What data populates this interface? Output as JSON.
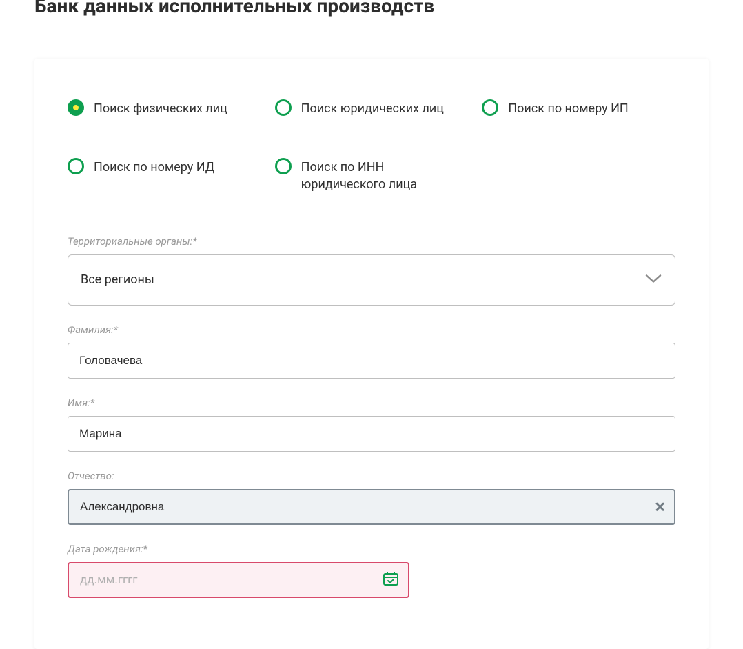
{
  "title": "Банк данных исполнительных производств",
  "radios": [
    {
      "label": "Поиск физических лиц",
      "selected": true
    },
    {
      "label": "Поиск юридических лиц",
      "selected": false
    },
    {
      "label": "Поиск по номеру ИП",
      "selected": false
    },
    {
      "label": "Поиск по номеру ИД",
      "selected": false
    },
    {
      "label": "Поиск по ИНН юридического лица",
      "selected": false
    }
  ],
  "fields": {
    "region": {
      "label": "Территориальные органы:*",
      "value": "Все регионы"
    },
    "surname": {
      "label": "Фамилия:*",
      "value": "Головачева"
    },
    "name": {
      "label": "Имя:*",
      "value": "Марина"
    },
    "patronymic": {
      "label": "Отчество:",
      "value": "Александровна"
    },
    "birthdate": {
      "label": "Дата рождения:*",
      "placeholder": "дд.мм.гггг"
    }
  }
}
